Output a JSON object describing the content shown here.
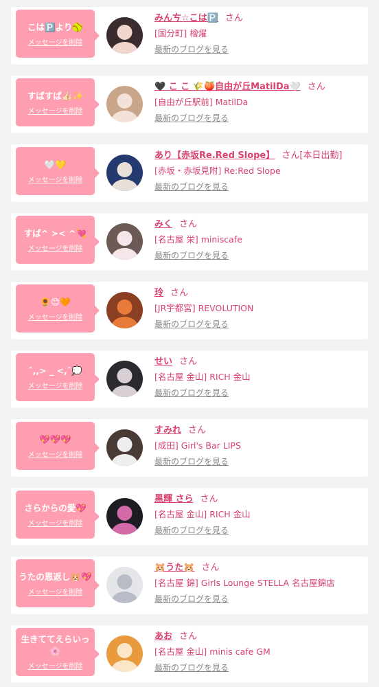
{
  "cards": [
    {
      "message": "こは🅿️より🥎",
      "delete_label": "メッセージを削除",
      "name": "みんㄘ☆こは🅿️",
      "honorific": "さん",
      "badge": "",
      "shop": "[国分町] 檜燿",
      "blog_label": "最新のブログを見る",
      "avatar_colors": [
        "#3a2c2e",
        "#f0d6cc"
      ]
    },
    {
      "message": "すばすば👍🏻✨",
      "delete_label": "メッセージを削除",
      "name": "🖤 こ こ 🌾🍑自由が丘MatilDa🤍",
      "honorific": "さん",
      "badge": "",
      "shop": "[自由が丘駅前] MatilDa",
      "blog_label": "最新のブログを見る",
      "avatar_colors": [
        "#c9a58a",
        "#f3e2d8"
      ]
    },
    {
      "message": "🤍💛",
      "delete_label": "メッセージを削除",
      "name": "あり【赤坂Re.Red Slope】",
      "honorific": "さん",
      "badge": "[本日出勤]",
      "shop": "[赤坂・赤坂見附] Re:Red Slope",
      "blog_label": "最新のブログを見る",
      "avatar_colors": [
        "#243a6e",
        "#e8dfd8"
      ]
    },
    {
      "message": "すば^ ≻< ^💘",
      "delete_label": "メッセージを削除",
      "name": "みく",
      "honorific": "さん",
      "badge": "",
      "shop": "[名古屋 栄] miniscafe",
      "blog_label": "最新のブログを見る",
      "avatar_colors": [
        "#6b5a55",
        "#f5e6ea"
      ]
    },
    {
      "message": "🌻😊🧡",
      "delete_label": "メッセージを削除",
      "name": "玲",
      "honorific": "さん",
      "badge": "",
      "shop": "[JR宇都宮] REVOLUTION",
      "blog_label": "最新のブログを見る",
      "avatar_colors": [
        "#8a3e22",
        "#e87a3a"
      ]
    },
    {
      "message": "ˆ,,> _ <,ˆ💭",
      "delete_label": "メッセージを削除",
      "name": "せい",
      "honorific": "さん",
      "badge": "",
      "shop": "[名古屋 金山] RICH 金山",
      "blog_label": "最新のブログを見る",
      "avatar_colors": [
        "#2a2a30",
        "#d8d0d4"
      ]
    },
    {
      "message": "💖💖💖",
      "delete_label": "メッセージを削除",
      "name": "すみれ",
      "honorific": "さん",
      "badge": "",
      "shop": "[成田] Girl's Bar LIPS",
      "blog_label": "最新のブログを見る",
      "avatar_colors": [
        "#4a3a36",
        "#eeeeee"
      ]
    },
    {
      "message": "さらからの愛💖",
      "delete_label": "メッセージを削除",
      "name": "黒輝 さら",
      "honorific": "さん",
      "badge": "",
      "shop": "[名古屋 金山] RICH 金山",
      "blog_label": "最新のブログを見る",
      "avatar_colors": [
        "#1c1c22",
        "#d36aa8"
      ]
    },
    {
      "message": "うたの恩返し🐹💖",
      "delete_label": "メッセージを削除",
      "name": "🐹うた🐹",
      "honorific": "さん",
      "badge": "",
      "shop": "[名古屋 錦] Girls Lounge STELLA 名古屋錦店",
      "blog_label": "最新のブログを見る",
      "avatar_colors": [
        "#e4e6ea",
        "#b8bcc6"
      ]
    },
    {
      "message": "生きててえらいっ🌸",
      "delete_label": "メッセージを削除",
      "name": "あお",
      "honorific": "さん",
      "badge": "",
      "shop": "[名古屋 金山] minis cafe GM",
      "blog_label": "最新のブログを見る",
      "avatar_colors": [
        "#e89a3c",
        "#fbe6c8"
      ]
    }
  ]
}
